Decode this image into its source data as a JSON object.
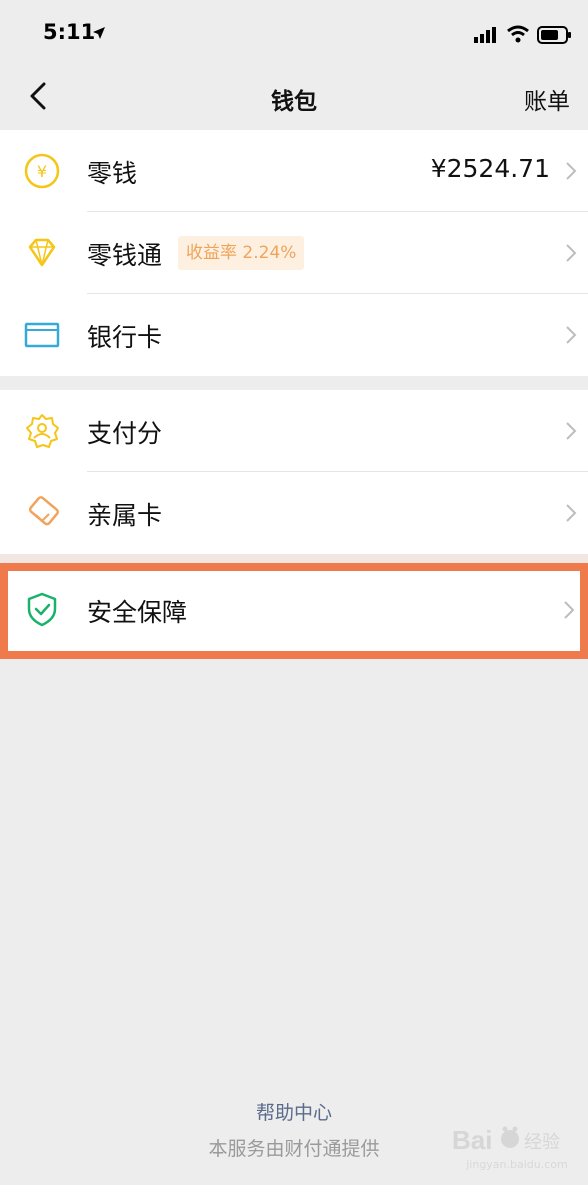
{
  "status_bar": {
    "time": "5:11"
  },
  "nav": {
    "title": "钱包",
    "right_action": "账单"
  },
  "group1": [
    {
      "label": "零钱",
      "value": "¥2524.71",
      "icon": "coin-icon"
    },
    {
      "label": "零钱通",
      "badge": "收益率 2.24%",
      "icon": "diamond-icon"
    },
    {
      "label": "银行卡",
      "icon": "bank-card-icon"
    }
  ],
  "group2": [
    {
      "label": "支付分",
      "icon": "pay-score-icon"
    },
    {
      "label": "亲属卡",
      "icon": "family-card-icon"
    }
  ],
  "highlighted": {
    "label": "安全保障",
    "icon": "shield-check-icon",
    "highlight_color": "#ef7a4c"
  },
  "footer": {
    "help": "帮助中心",
    "provider": "本服务由财付通提供"
  },
  "watermark": {
    "brand": "Bai",
    "label": "经验",
    "sub": "jingyan.baidu.com"
  },
  "colors": {
    "gold": "#f5c518",
    "blue": "#36a9d8",
    "green": "#18b26b",
    "orange": "#f0a45a"
  }
}
